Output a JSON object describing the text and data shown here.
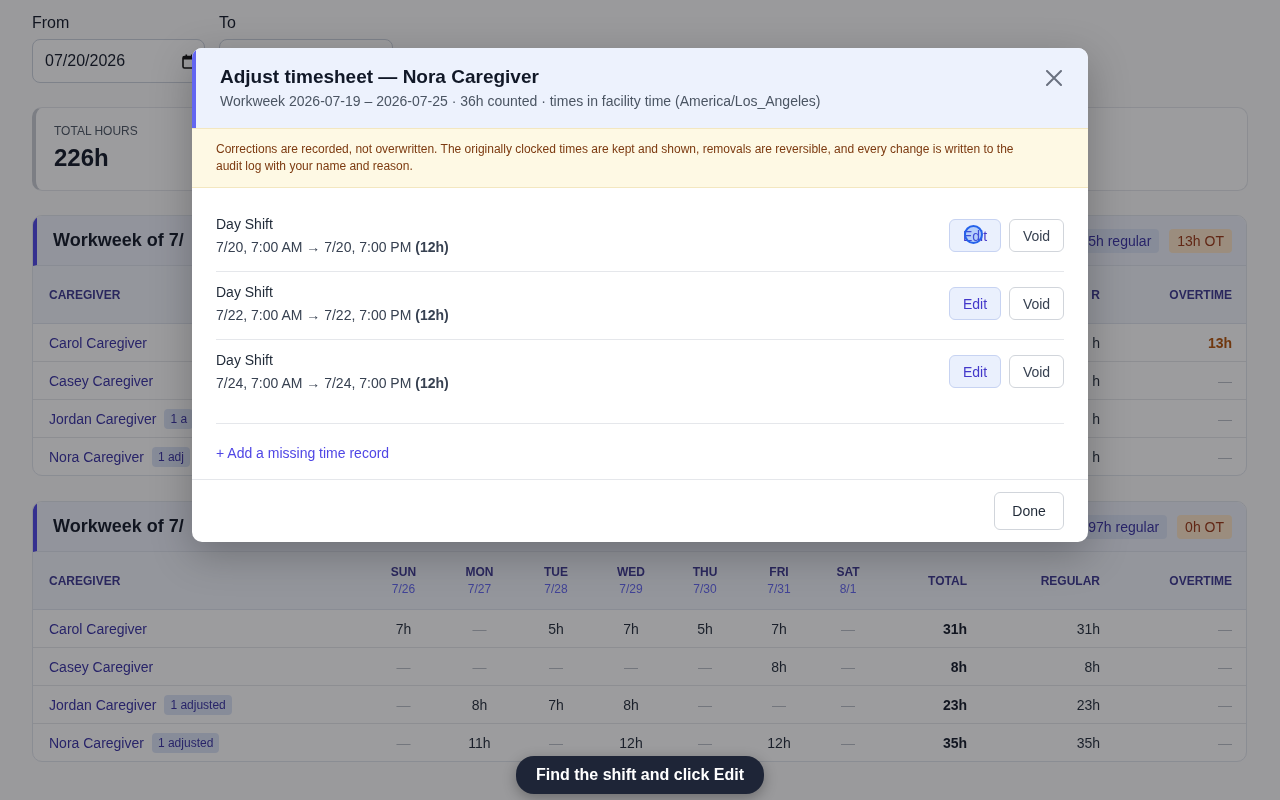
{
  "filters": {
    "from": {
      "label": "From",
      "value": "07/20/2026"
    },
    "to": {
      "label": "To"
    }
  },
  "stats": [
    {
      "label": "TOTAL HOURS",
      "value": "226h"
    }
  ],
  "weeks": [
    {
      "title": "Workweek of 7/",
      "badges": [
        {
          "kind": "regular",
          "text": "5h regular"
        },
        {
          "kind": "ot",
          "text": "13h OT"
        }
      ],
      "columns": [
        {
          "kind": "name",
          "label": "CAREGIVER"
        },
        {
          "kind": "regular",
          "label": "R"
        },
        {
          "kind": "overtime",
          "label": "OVERTIME"
        }
      ],
      "rows": [
        {
          "cells": [
            {
              "text": "Carol Caregiver",
              "kind": "name"
            },
            {
              "text": "h",
              "kind": "value"
            },
            {
              "text": "13h",
              "kind": "alert"
            }
          ]
        },
        {
          "cells": [
            {
              "text": "Casey Caregiver",
              "kind": "name"
            },
            {
              "text": "h",
              "kind": "value"
            },
            {
              "text": "—",
              "kind": "empty"
            }
          ]
        },
        {
          "cells": [
            {
              "text": "Jordan Caregiver",
              "kind": "name",
              "badge": "1 a"
            },
            {
              "text": "h",
              "kind": "value"
            },
            {
              "text": "—",
              "kind": "empty"
            }
          ]
        },
        {
          "cells": [
            {
              "text": "Nora Caregiver",
              "kind": "name",
              "badge": "1 adj"
            },
            {
              "text": "h",
              "kind": "value"
            },
            {
              "text": "—",
              "kind": "empty"
            }
          ]
        }
      ]
    },
    {
      "title": "Workweek of 7/",
      "badges": [
        {
          "kind": "regular",
          "text": "97h regular"
        },
        {
          "kind": "ot",
          "text": "0h OT"
        }
      ],
      "columns": [
        {
          "kind": "name",
          "label": "CAREGIVER"
        },
        {
          "kind": "day",
          "label": "SUN",
          "date": "7/26"
        },
        {
          "kind": "day",
          "label": "MON",
          "date": "7/27"
        },
        {
          "kind": "day",
          "label": "TUE",
          "date": "7/28"
        },
        {
          "kind": "day",
          "label": "WED",
          "date": "7/29"
        },
        {
          "kind": "day",
          "label": "THU",
          "date": "7/30"
        },
        {
          "kind": "day",
          "label": "FRI",
          "date": "7/31"
        },
        {
          "kind": "day",
          "label": "SAT",
          "date": "8/1"
        },
        {
          "kind": "total",
          "label": "TOTAL"
        },
        {
          "kind": "regular",
          "label": "REGULAR"
        },
        {
          "kind": "overtime",
          "label": "OVERTIME"
        }
      ],
      "rows": [
        {
          "cells": [
            {
              "text": "Carol Caregiver",
              "kind": "name"
            },
            {
              "text": "7h",
              "kind": "value"
            },
            {
              "text": "—",
              "kind": "empty"
            },
            {
              "text": "5h",
              "kind": "value"
            },
            {
              "text": "7h",
              "kind": "value"
            },
            {
              "text": "5h",
              "kind": "value"
            },
            {
              "text": "7h",
              "kind": "value"
            },
            {
              "text": "—",
              "kind": "empty"
            },
            {
              "text": "31h",
              "kind": "value"
            },
            {
              "text": "31h",
              "kind": "value"
            },
            {
              "text": "—",
              "kind": "empty"
            }
          ]
        },
        {
          "cells": [
            {
              "text": "Casey Caregiver",
              "kind": "name"
            },
            {
              "text": "—",
              "kind": "empty"
            },
            {
              "text": "—",
              "kind": "empty"
            },
            {
              "text": "—",
              "kind": "empty"
            },
            {
              "text": "—",
              "kind": "empty"
            },
            {
              "text": "—",
              "kind": "empty"
            },
            {
              "text": "8h",
              "kind": "value"
            },
            {
              "text": "—",
              "kind": "empty"
            },
            {
              "text": "8h",
              "kind": "value"
            },
            {
              "text": "8h",
              "kind": "value"
            },
            {
              "text": "—",
              "kind": "empty"
            }
          ]
        },
        {
          "cells": [
            {
              "text": "Jordan Caregiver",
              "kind": "name",
              "badge": "1 adjusted"
            },
            {
              "text": "—",
              "kind": "empty"
            },
            {
              "text": "8h",
              "kind": "value"
            },
            {
              "text": "7h",
              "kind": "value"
            },
            {
              "text": "8h",
              "kind": "value"
            },
            {
              "text": "—",
              "kind": "empty"
            },
            {
              "text": "—",
              "kind": "empty"
            },
            {
              "text": "—",
              "kind": "empty"
            },
            {
              "text": "23h",
              "kind": "value"
            },
            {
              "text": "23h",
              "kind": "value"
            },
            {
              "text": "—",
              "kind": "empty"
            }
          ]
        },
        {
          "cells": [
            {
              "text": "Nora Caregiver",
              "kind": "name",
              "badge": "1 adjusted"
            },
            {
              "text": "—",
              "kind": "empty"
            },
            {
              "text": "11h",
              "kind": "value"
            },
            {
              "text": "—",
              "kind": "empty"
            },
            {
              "text": "12h",
              "kind": "value"
            },
            {
              "text": "—",
              "kind": "empty"
            },
            {
              "text": "12h",
              "kind": "value"
            },
            {
              "text": "—",
              "kind": "empty"
            },
            {
              "text": "35h",
              "kind": "value"
            },
            {
              "text": "35h",
              "kind": "value"
            },
            {
              "text": "—",
              "kind": "empty"
            }
          ]
        }
      ]
    }
  ],
  "modal": {
    "title": "Adjust timesheet — Nora Caregiver",
    "subtitle": "Workweek 2026-07-19 – 2026-07-25 · 36h counted · times in facility time (America/Los_Angeles)",
    "notice": "Corrections are recorded, not overwritten. The originally clocked times are kept and shown, removals are reversible, and every change is written to the audit log with your name and reason.",
    "shifts": [
      {
        "title": "Day Shift",
        "time": "7/20, 7:00 AM → 7/20, 7:00 PM **(12h)**",
        "edit": "Edit",
        "void": "Void",
        "clicked": true
      },
      {
        "title": "Day Shift",
        "time": "7/22, 7:00 AM → 7/22, 7:00 PM **(12h)**",
        "edit": "Edit",
        "void": "Void",
        "clicked": false
      },
      {
        "title": "Day Shift",
        "time": "7/24, 7:00 AM → 7/24, 7:00 PM **(12h)**",
        "edit": "Edit",
        "void": "Void",
        "clicked": false
      }
    ],
    "add_link": "+ Add a missing time record",
    "done": "Done"
  },
  "toast": "Find the shift and click Edit"
}
